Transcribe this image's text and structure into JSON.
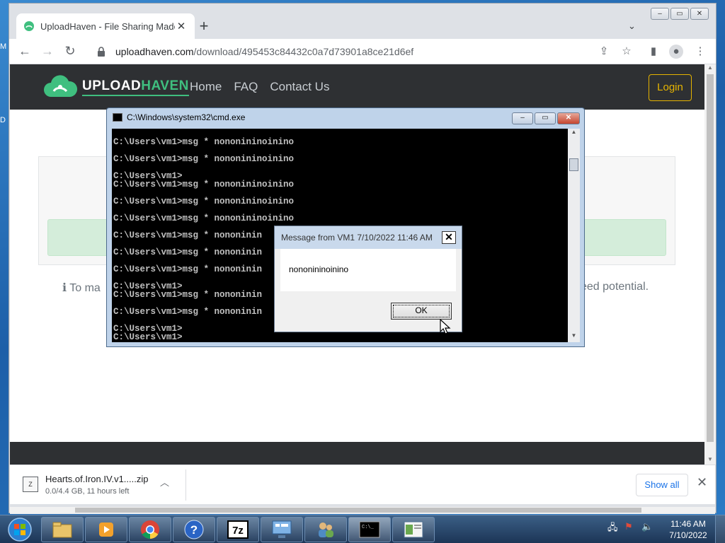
{
  "browser": {
    "tab_title": "UploadHaven - File Sharing Made",
    "tab_close": "✕",
    "new_tab": "+",
    "url_host": "uploadhaven.com",
    "url_path": "/download/495453c84432c0a7d73901a8ce21d6ef"
  },
  "site": {
    "brand_upload": "UPLOAD",
    "brand_haven": "HAVEN",
    "nav": [
      "Home",
      "FAQ",
      "Contact Us"
    ],
    "login": "Login",
    "info_left": "To ma",
    "info_right": "eed potential."
  },
  "cmd": {
    "title": "C:\\Windows\\system32\\cmd.exe",
    "lines": [
      "C:\\Users\\vm1>msg * nononininoinino",
      "C:\\Users\\vm1>msg * nononininoinino",
      "C:\\Users\\vm1>",
      "C:\\Users\\vm1>msg * nononininoinino",
      "C:\\Users\\vm1>msg * nononininoinino",
      "C:\\Users\\vm1>msg * nononininoinino",
      "C:\\Users\\vm1>msg * nononinin",
      "C:\\Users\\vm1>msg * nononinin",
      "C:\\Users\\vm1>msg * nononinin",
      "C:\\Users\\vm1>",
      "C:\\Users\\vm1>msg * nononinin",
      "C:\\Users\\vm1>msg * nononinin",
      "C:\\Users\\vm1>",
      "C:\\Users\\vm1>"
    ]
  },
  "msgbox": {
    "title": "Message from VM1 7/10/2022 11:46 AM",
    "text": "nononininoinino",
    "ok": "OK",
    "close": "✕"
  },
  "download": {
    "file_name": "Hearts.of.Iron.IV.v1.....zip",
    "status": "0.0/4.4 GB, 11 hours left",
    "show_all": "Show all",
    "close": "✕"
  },
  "taskbar": {
    "time": "11:46 AM",
    "date": "7/10/2022"
  },
  "colors": {
    "site_nav_bg": "#2e3033",
    "brand_green": "#3fbf7f",
    "login_yellow": "#e6b400",
    "alert_green": "#d4edda"
  }
}
